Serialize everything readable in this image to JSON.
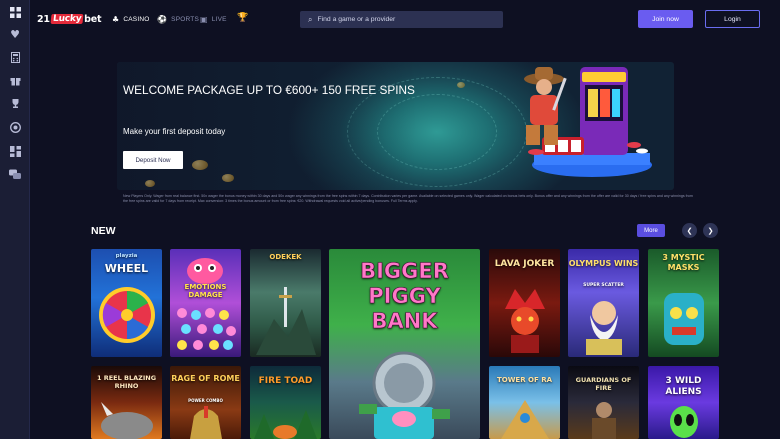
{
  "brand": {
    "logo_prefix": "21",
    "logo_lucky": "Lucky",
    "logo_suffix": "bet",
    "accent": "#6a5cf0"
  },
  "nav": {
    "casino": "CASINO",
    "sports": "SPORTS",
    "live": "LIVE"
  },
  "search": {
    "placeholder": "Find a game or a provider"
  },
  "auth": {
    "join": "Join now",
    "login": "Login"
  },
  "sidebar": {
    "icons": [
      "grid-icon",
      "heart-icon",
      "calculator-icon",
      "gift-icon",
      "trophy-icon",
      "chip-icon",
      "blocks-icon",
      "chat-icon"
    ]
  },
  "hero": {
    "title": "WELCOME PACKAGE UP TO €600+ 150 FREE SPINS",
    "subtitle": "Make your first deposit today",
    "button": "Deposit Now",
    "terms": "New Players Only. Wager from real balance first. 50x wager the bonus money within 30 days and 50x wager any winnings from the free spins within 7 days. Contribution varies per game. Available on selected games only. Wager calculated on bonus bets only. Bonus offer and any winnings from the offer are valid for 30 days / free spins and any winnings from the free spins are valid for 7 days from receipt. Max conversion: 3 times the bonus amount or from free spins: €20. Withdrawal requests void all active/pending bonuses. Full Terms apply."
  },
  "section": {
    "title": "NEW",
    "more": "More"
  },
  "games": [
    {
      "name": "WHEEL",
      "provider": "playzia"
    },
    {
      "name": "EMOTIONS DAMAGE"
    },
    {
      "name": "ODEKEK"
    },
    {
      "name": "BIGGER PIGGY BANK"
    },
    {
      "name": "LAVA JOKER"
    },
    {
      "name": "OLYMPUS WINS",
      "badge": "SUPER SCATTER"
    },
    {
      "name": "3 MYSTIC MASKS"
    },
    {
      "name": "1 REEL BLAZING RHINO"
    },
    {
      "name": "RAGE OF ROME",
      "badge": "POWER COMBO"
    },
    {
      "name": "FIRE TOAD"
    },
    {
      "name": "TOWER OF RA"
    },
    {
      "name": "GUARDIANS OF FIRE"
    },
    {
      "name": "3 WILD ALIENS"
    }
  ]
}
